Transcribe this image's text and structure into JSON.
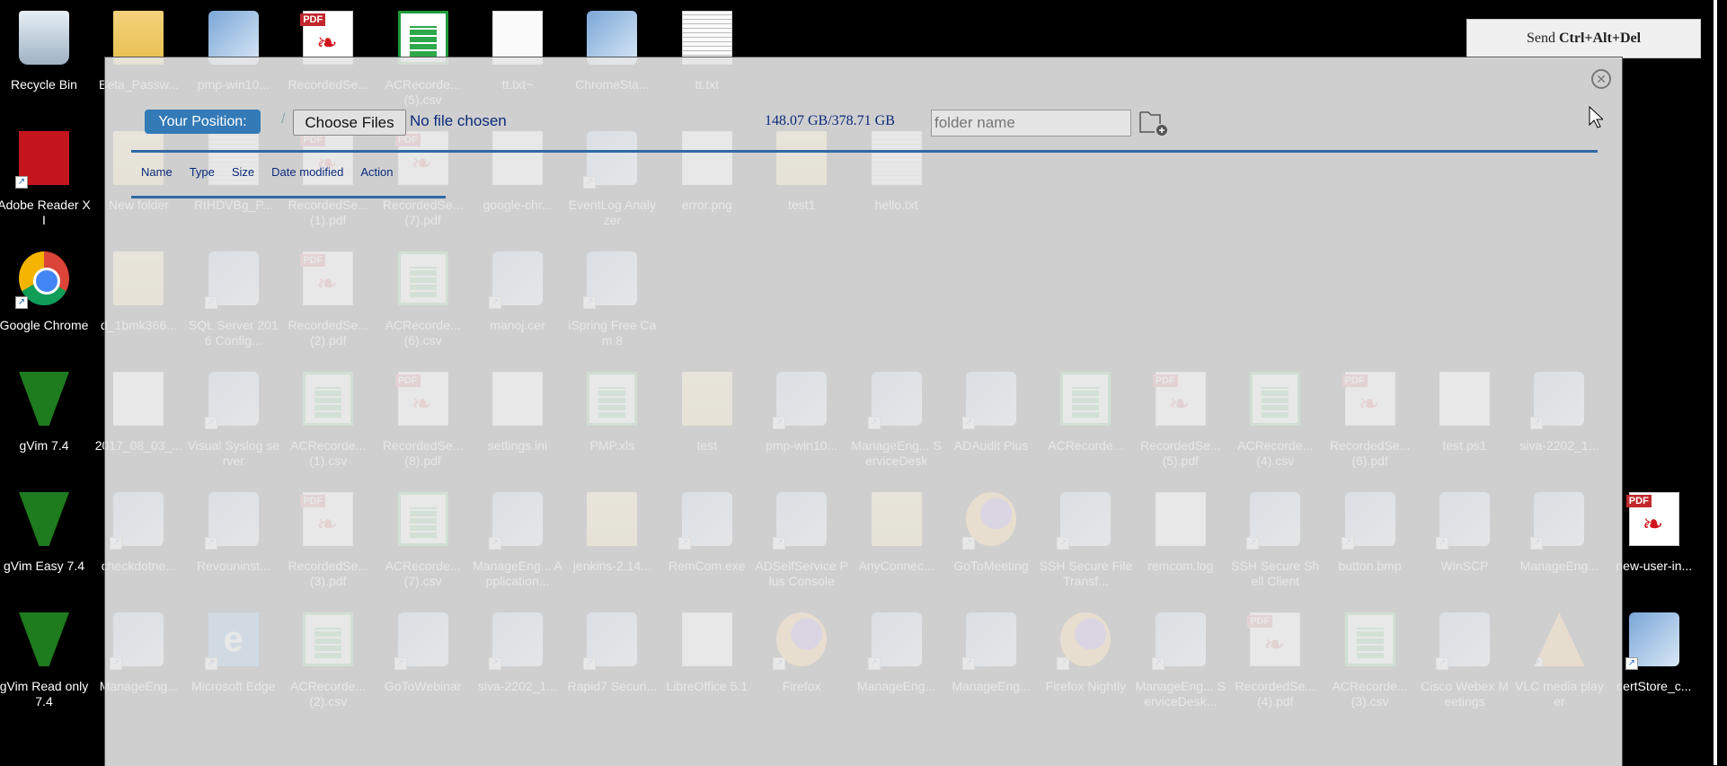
{
  "desktop": {
    "rows": [
      [
        [
          "Recycle Bin",
          "recycle"
        ],
        [
          "Beta_Passw...",
          "folder"
        ],
        [
          "pmp-win10...",
          "app"
        ],
        [
          "RecordedSe...",
          "pdf"
        ],
        [
          "ACRecorde... (5).csv",
          "csv"
        ],
        [
          "tt.txt~",
          "txt"
        ],
        [
          "ChromeSta...",
          "app"
        ],
        [
          "tt.txt",
          "lines"
        ]
      ],
      [
        [
          "Adobe Reader XI",
          "reader"
        ],
        [
          "New folder",
          "folder"
        ],
        [
          "RtHDVBg_P...",
          "lines"
        ],
        [
          "RecordedSe... (1).pdf",
          "pdf"
        ],
        [
          "RecordedSe... (7).pdf",
          "pdf"
        ],
        [
          "google-chr...",
          "txt"
        ],
        [
          "EventLog Analyzer",
          "app"
        ],
        [
          "error.png",
          "txt"
        ],
        [
          "test1",
          "folder"
        ],
        [
          "hello.txt",
          "lines"
        ]
      ],
      [
        [
          "Google Chrome",
          "chrome"
        ],
        [
          "d_1bmk366...",
          "folder"
        ],
        [
          "SQL Server 2016 Config...",
          "app"
        ],
        [
          "RecordedSe... (2).pdf",
          "pdf"
        ],
        [
          "ACRecorde... (6).csv",
          "csv"
        ],
        [
          "manoj.cer",
          "app"
        ],
        [
          "iSpring Free Cam 8",
          "app"
        ]
      ],
      [
        [
          "gVim 7.4",
          "vim"
        ],
        [
          "2017_08_03_...",
          "txt"
        ],
        [
          "Visual Syslog server",
          "app"
        ],
        [
          "ACRecorde... (1).csv",
          "csv"
        ],
        [
          "RecordedSe... (8).pdf",
          "pdf"
        ],
        [
          "settings.ini",
          "txt"
        ],
        [
          "PMP.xls",
          "csv"
        ],
        [
          "test",
          "folder"
        ],
        [
          "pmp-win10...",
          "app"
        ],
        [
          "ManageEng... ServiceDesk",
          "app"
        ],
        [
          "ADAudit Plus",
          "app"
        ],
        [
          "ACRecorde...",
          "csv"
        ],
        [
          "RecordedSe... (5).pdf",
          "pdf"
        ],
        [
          "ACRecorde... (4).csv",
          "csv"
        ],
        [
          "RecordedSe... (6).pdf",
          "pdf"
        ],
        [
          "test.ps1",
          "txt"
        ],
        [
          "siva-2202_1...",
          "app"
        ]
      ],
      [
        [
          "gVim Easy 7.4",
          "vim"
        ],
        [
          "checkdotne...",
          "app"
        ],
        [
          "Revouninst...",
          "app"
        ],
        [
          "RecordedSe... (3).pdf",
          "pdf"
        ],
        [
          "ACRecorde... (7).csv",
          "csv"
        ],
        [
          "ManageEng... Application...",
          "app"
        ],
        [
          "jenkins-2.14...",
          "folder"
        ],
        [
          "RemCom.exe",
          "app"
        ],
        [
          "ADSelfService Plus Console",
          "app"
        ],
        [
          "AnyConnec...",
          "folder"
        ],
        [
          "GoToMeeting",
          "firefox"
        ],
        [
          "SSH Secure File Transf...",
          "app"
        ],
        [
          "remcom.log",
          "txt"
        ],
        [
          "SSH Secure Shell Client",
          "app"
        ],
        [
          "button.bmp",
          "app"
        ],
        [
          "WinSCP",
          "app"
        ],
        [
          "ManageEng...",
          "app"
        ],
        [
          "new-user-in...",
          "pdf"
        ]
      ],
      [
        [
          "gVim Read only 7.4",
          "vim"
        ],
        [
          "ManageEng...",
          "app"
        ],
        [
          "Microsoft Edge",
          "edge"
        ],
        [
          "ACRecorde... (2).csv",
          "csv"
        ],
        [
          "GoToWebinar",
          "app"
        ],
        [
          "siva-2202_1...",
          "app"
        ],
        [
          "Rapid7 Securi...",
          "app"
        ],
        [
          "LibreOffice 5.1",
          "txt"
        ],
        [
          "Firefox",
          "firefox"
        ],
        [
          "ManageEng...",
          "app"
        ],
        [
          "ManageEng...",
          "app"
        ],
        [
          "Firefox Nightly",
          "firefox"
        ],
        [
          "ManageEng... ServiceDesk...",
          "app"
        ],
        [
          "RecordedSe... (4).pdf",
          "pdf"
        ],
        [
          "ACRecorde... (3).csv",
          "csv"
        ],
        [
          "Cisco Webex Meetings",
          "app"
        ],
        [
          "VLC media player",
          "vlc"
        ],
        [
          "certStore_c...",
          "app"
        ]
      ]
    ]
  },
  "send_button": {
    "prefix": "Send ",
    "keys": "Ctrl+Alt+Del"
  },
  "file_manager": {
    "position_label": "Your Position:",
    "path": "/",
    "choose_files": "Choose Files",
    "no_file": "No file chosen",
    "usage": "148.07 GB/378.71 GB",
    "folder_placeholder": "folder name",
    "columns": [
      "Name",
      "Type",
      "Size",
      "Date modified",
      "Action"
    ],
    "close_icon": "close-circle-icon",
    "new_folder_icon": "folder-plus-icon"
  },
  "colors": {
    "accent": "#337ab7",
    "line": "#2f6aa6",
    "text_link": "#0a2a7a"
  }
}
